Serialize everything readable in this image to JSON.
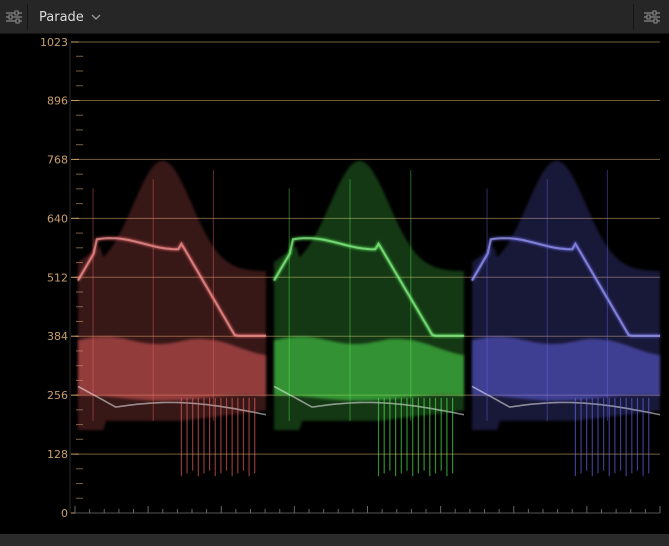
{
  "header": {
    "title": "Parade",
    "left_icon": "sliders-icon",
    "right_icon": "sliders-icon",
    "dropdown_icon": "chevron-down-icon"
  },
  "colors": {
    "header_bg": "#262626",
    "scope_bg": "#000000",
    "gridline": "#8a6f47",
    "tick_label": "#c9a06a",
    "red_trace": "#ff6a6a",
    "green_trace": "#5aff5a",
    "blue_trace": "#6e6eff"
  },
  "chart_data": {
    "type": "waveform",
    "scope": "Parade",
    "channels": [
      "red",
      "green",
      "blue"
    ],
    "title": "",
    "xlabel": "",
    "ylabel": "",
    "ylim": [
      0,
      1023
    ],
    "yticks": [
      0,
      128,
      256,
      384,
      512,
      640,
      768,
      896,
      1023
    ],
    "ytick_labels": [
      "0",
      "128",
      "256",
      "384",
      "512",
      "640",
      "768",
      "896",
      "1023"
    ],
    "grid": true,
    "features": {
      "top_peak": 765,
      "upper_ridge": 585,
      "mid_band_high": 385,
      "mid_band_low": 250,
      "lower_edge": 200,
      "bottom_min": 80
    }
  }
}
